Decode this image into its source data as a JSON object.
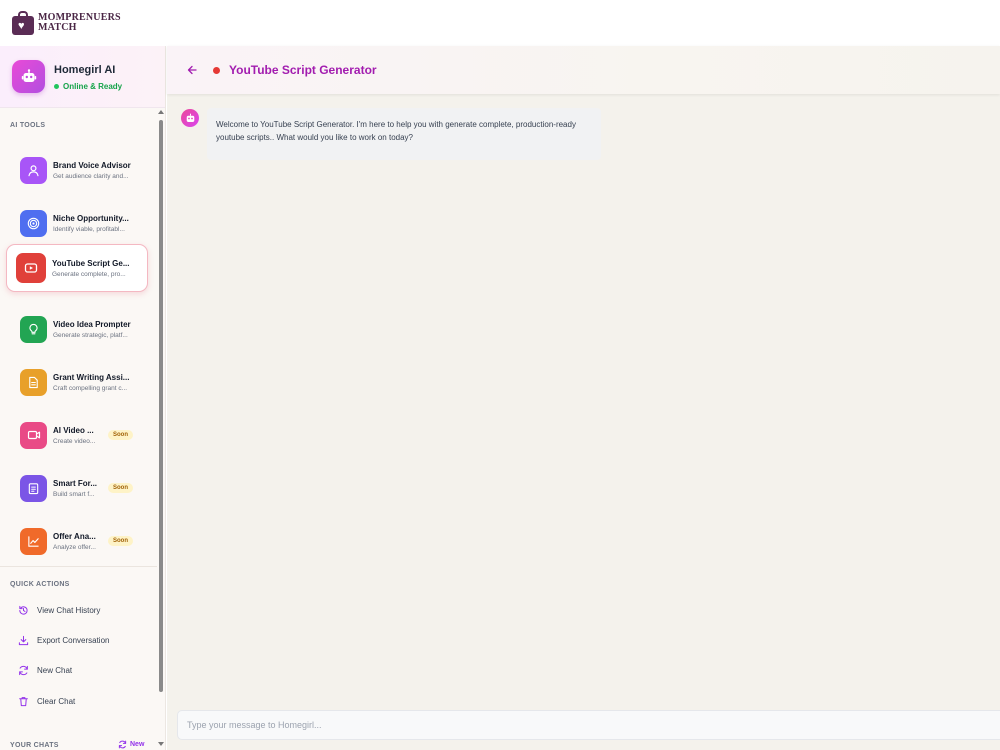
{
  "brand": {
    "name_line1": "MOMPRENUERS",
    "name_line2": "MATCH"
  },
  "assistant": {
    "name": "Homegirl AI",
    "status": "Online & Ready"
  },
  "sidebar": {
    "tools_label": "AI TOOLS",
    "tools": [
      {
        "title": "Brand Voice Advisor",
        "desc": "Get audience clarity and...",
        "icon": "user-icon",
        "color": "#a855f7",
        "soon": null
      },
      {
        "title": "Niche Opportunity...",
        "desc": "Identify viable, profitabl...",
        "icon": "target-icon",
        "color": "#4f6ef0",
        "soon": null
      },
      {
        "title": "YouTube Script Ge...",
        "desc": "Generate complete, pro...",
        "icon": "youtube-icon",
        "color": "#e0403a",
        "soon": null
      },
      {
        "title": "Video Idea Prompter",
        "desc": "Generate strategic, platf...",
        "icon": "lightbulb-icon",
        "color": "#22a553",
        "soon": null
      },
      {
        "title": "Grant Writing Assi...",
        "desc": "Craft compelling grant c...",
        "icon": "document-icon",
        "color": "#e8a02a",
        "soon": null
      },
      {
        "title": "AI Video ...",
        "desc": "Create video...",
        "icon": "video-icon",
        "color": "#e94a86",
        "soon": "Soon"
      },
      {
        "title": "Smart For...",
        "desc": "Build smart f...",
        "icon": "clipboard-icon",
        "color": "#7b55e6",
        "soon": "Soon"
      },
      {
        "title": "Offer Ana...",
        "desc": "Analyze offer...",
        "icon": "chart-icon",
        "color": "#f06a2a",
        "soon": "Soon"
      }
    ],
    "quick_label": "QUICK ACTIONS",
    "quick_actions": [
      {
        "label": "View Chat History",
        "icon": "history-icon"
      },
      {
        "label": "Export Conversation",
        "icon": "download-icon"
      },
      {
        "label": "New Chat",
        "icon": "refresh-icon"
      },
      {
        "label": "Clear Chat",
        "icon": "trash-icon"
      }
    ],
    "your_chats_label": "YOUR CHATS",
    "new_label": "New"
  },
  "chat": {
    "title": "YouTube Script Generator",
    "status_color": "#e53935",
    "messages": [
      {
        "role": "assistant",
        "text": "Welcome to YouTube Script Generator. I'm here to help you with generate complete, production-ready youtube scripts.. What would you like to work on today?"
      }
    ],
    "input_placeholder": "Type your message to Homegirl..."
  }
}
